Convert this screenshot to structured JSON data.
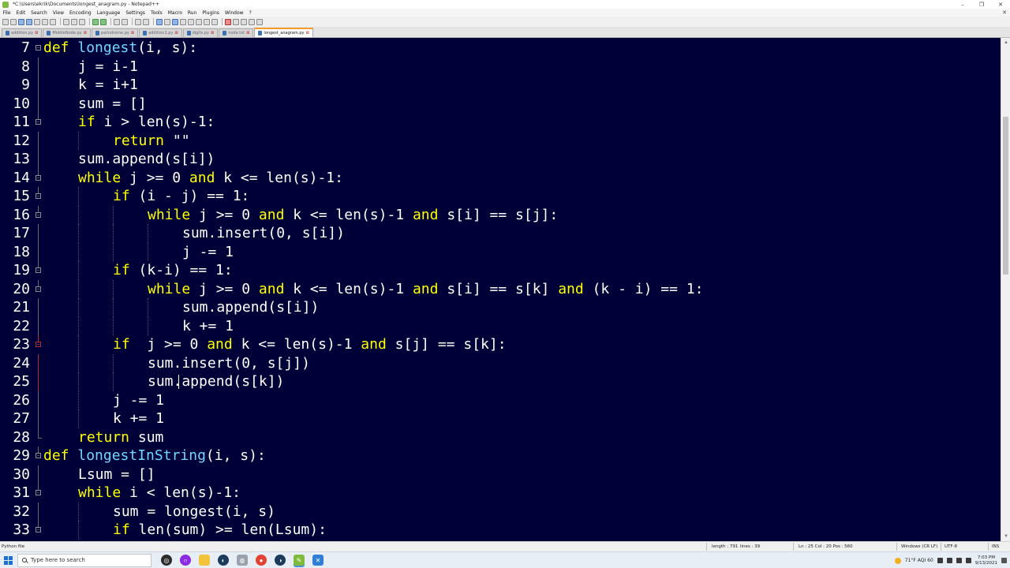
{
  "window": {
    "title": "*C:\\Users\\ekrik\\Documents\\longest_anagram.py - Notepad++",
    "controls": [
      "–",
      "❐",
      "✕"
    ]
  },
  "menu": [
    "File",
    "Edit",
    "Search",
    "View",
    "Encoding",
    "Language",
    "Settings",
    "Tools",
    "Macro",
    "Run",
    "Plugins",
    "Window",
    "?"
  ],
  "menu_close": "✕",
  "tabs": [
    {
      "label": "addition.py",
      "active": false
    },
    {
      "label": "MiddleNode.py",
      "active": false
    },
    {
      "label": "palindrome.py",
      "active": false
    },
    {
      "label": "addition2.py",
      "active": false
    },
    {
      "label": "digits.py",
      "active": false
    },
    {
      "label": "node.txt",
      "active": false
    },
    {
      "label": "longest_anagram.py",
      "active": true
    }
  ],
  "editor": {
    "lines": [
      {
        "n": "7",
        "indent": 0,
        "fold": "box",
        "tokens": [
          [
            "k",
            "def "
          ],
          [
            "f",
            "longest"
          ],
          [
            "s",
            "(i, s):"
          ]
        ]
      },
      {
        "n": "8",
        "indent": 1,
        "fold": "line",
        "tokens": [
          [
            "s",
            "j = i-1"
          ]
        ]
      },
      {
        "n": "9",
        "indent": 1,
        "fold": "line",
        "tokens": [
          [
            "s",
            "k = i+1"
          ]
        ]
      },
      {
        "n": "10",
        "indent": 1,
        "fold": "line",
        "tokens": [
          [
            "s",
            "sum = []"
          ]
        ]
      },
      {
        "n": "11",
        "indent": 1,
        "fold": "box",
        "tokens": [
          [
            "k",
            "if "
          ],
          [
            "s",
            "i > len(s)-1:"
          ]
        ]
      },
      {
        "n": "12",
        "indent": 2,
        "fold": "line",
        "tokens": [
          [
            "k",
            "return "
          ],
          [
            "s",
            "\"\""
          ]
        ]
      },
      {
        "n": "13",
        "indent": 1,
        "fold": "line",
        "tokens": [
          [
            "s",
            "sum.append(s[i])"
          ]
        ]
      },
      {
        "n": "14",
        "indent": 1,
        "fold": "box",
        "tokens": [
          [
            "k",
            "while "
          ],
          [
            "s",
            "j >= 0 "
          ],
          [
            "k",
            "and "
          ],
          [
            "s",
            "k <= len(s)-1:"
          ]
        ]
      },
      {
        "n": "15",
        "indent": 2,
        "fold": "box",
        "tokens": [
          [
            "k",
            "if "
          ],
          [
            "s",
            "(i - j) == 1:"
          ]
        ]
      },
      {
        "n": "16",
        "indent": 3,
        "fold": "box",
        "tokens": [
          [
            "k",
            "while "
          ],
          [
            "s",
            "j >= 0 "
          ],
          [
            "k",
            "and "
          ],
          [
            "s",
            "k <= len(s)-1 "
          ],
          [
            "k",
            "and "
          ],
          [
            "s",
            "s[i] == s[j]:"
          ]
        ]
      },
      {
        "n": "17",
        "indent": 4,
        "fold": "line",
        "tokens": [
          [
            "s",
            "sum.insert(0, s[i])"
          ]
        ]
      },
      {
        "n": "18",
        "indent": 4,
        "fold": "line",
        "tokens": [
          [
            "s",
            "j -= 1"
          ]
        ]
      },
      {
        "n": "19",
        "indent": 2,
        "fold": "box",
        "tokens": [
          [
            "k",
            "if "
          ],
          [
            "s",
            "(k-i) == 1:"
          ]
        ]
      },
      {
        "n": "20",
        "indent": 3,
        "fold": "box",
        "tokens": [
          [
            "k",
            "while "
          ],
          [
            "s",
            "j >= 0 "
          ],
          [
            "k",
            "and "
          ],
          [
            "s",
            "k <= len(s)-1 "
          ],
          [
            "k",
            "and "
          ],
          [
            "s",
            "s[i] == s[k] "
          ],
          [
            "k",
            "and "
          ],
          [
            "s",
            "(k - i) == 1:"
          ]
        ]
      },
      {
        "n": "21",
        "indent": 4,
        "fold": "line",
        "tokens": [
          [
            "s",
            "sum.append(s[i])"
          ]
        ]
      },
      {
        "n": "22",
        "indent": 4,
        "fold": "line",
        "tokens": [
          [
            "s",
            "k += 1"
          ]
        ]
      },
      {
        "n": "23",
        "indent": 2,
        "fold": "redbox",
        "tokens": [
          [
            "k",
            "if  "
          ],
          [
            "s",
            "j >= 0 "
          ],
          [
            "k",
            "and "
          ],
          [
            "s",
            "k <= len(s)-1 "
          ],
          [
            "k",
            "and "
          ],
          [
            "s",
            "s[j] == s[k]:"
          ]
        ]
      },
      {
        "n": "24",
        "indent": 3,
        "fold": "redline",
        "tokens": [
          [
            "s",
            "sum.insert(0, s[j])"
          ]
        ]
      },
      {
        "n": "25",
        "indent": 3,
        "fold": "redline",
        "tokens": [
          [
            "s",
            "sum.append(s[k])"
          ]
        ]
      },
      {
        "n": "26",
        "indent": 2,
        "fold": "line",
        "tokens": [
          [
            "s",
            "j -= 1"
          ]
        ]
      },
      {
        "n": "27",
        "indent": 2,
        "fold": "line",
        "tokens": [
          [
            "s",
            "k += 1"
          ]
        ]
      },
      {
        "n": "28",
        "indent": 1,
        "fold": "end",
        "tokens": [
          [
            "k",
            "return "
          ],
          [
            "s",
            "sum"
          ]
        ]
      },
      {
        "n": "29",
        "indent": 0,
        "fold": "box",
        "tokens": [
          [
            "k",
            "def "
          ],
          [
            "f",
            "longestInString"
          ],
          [
            "s",
            "(i, s):"
          ]
        ]
      },
      {
        "n": "30",
        "indent": 1,
        "fold": "line",
        "tokens": [
          [
            "s",
            "Lsum = []"
          ]
        ]
      },
      {
        "n": "31",
        "indent": 1,
        "fold": "box",
        "tokens": [
          [
            "k",
            "while "
          ],
          [
            "s",
            "i < len(s)-1:"
          ]
        ]
      },
      {
        "n": "32",
        "indent": 2,
        "fold": "line",
        "tokens": [
          [
            "s",
            "sum = longest(i, s)"
          ]
        ]
      },
      {
        "n": "33",
        "indent": 2,
        "fold": "box",
        "tokens": [
          [
            "k",
            "if "
          ],
          [
            "s",
            "len(sum) >= len(Lsum):"
          ]
        ]
      }
    ]
  },
  "statusbar": {
    "filetype": "Python file",
    "length": "length : 791",
    "lines": "lines : 39",
    "position": "Ln : 25    Col : 20    Pos : 560",
    "eol": "Windows (CR LF)",
    "encoding": "UTF-8",
    "mode": "INS"
  },
  "taskbar": {
    "search_placeholder": "Type here to search",
    "weather": "71°F  AQI 60",
    "time": "7:03 PM",
    "date": "9/13/2021"
  },
  "colors": {
    "editor_bg": "#000038",
    "keyword": "#ffff00",
    "function_name": "#70d8ff",
    "text": "#ffffff"
  }
}
